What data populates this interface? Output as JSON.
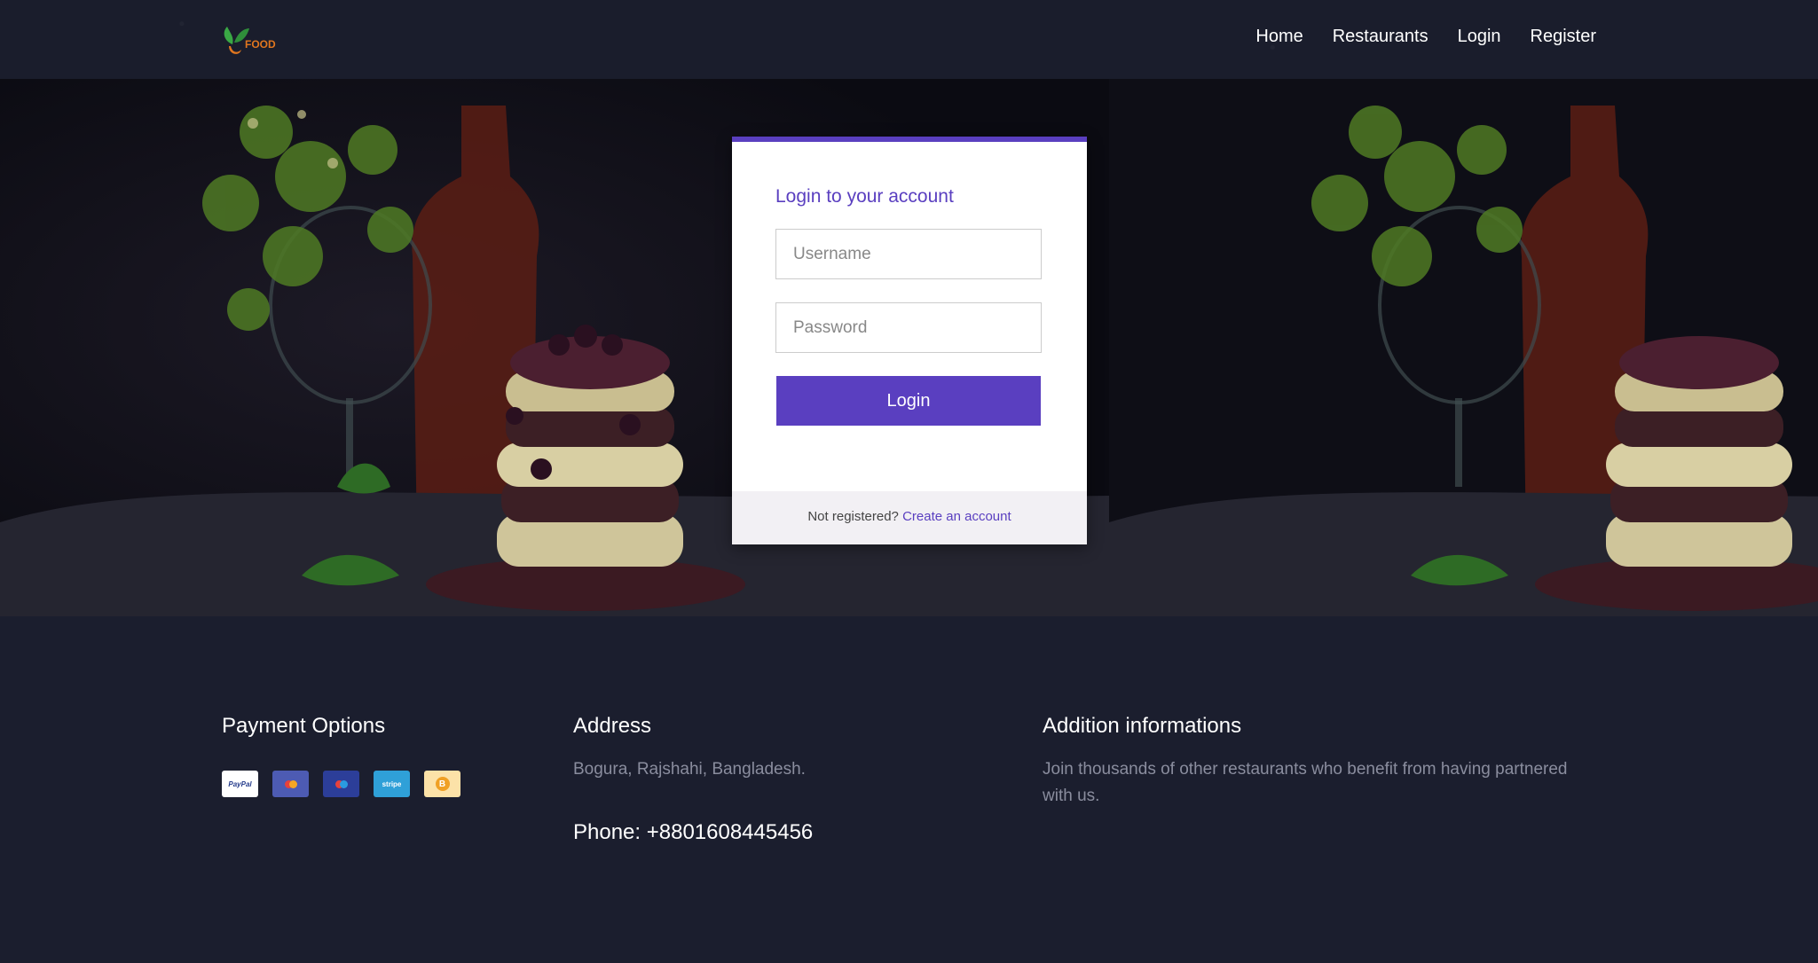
{
  "header": {
    "logo_text": "FOOD",
    "nav": [
      {
        "label": "Home"
      },
      {
        "label": "Restaurants"
      },
      {
        "label": "Login"
      },
      {
        "label": "Register"
      }
    ]
  },
  "login_card": {
    "title": "Login to your account",
    "username_placeholder": "Username",
    "username_value": "",
    "password_placeholder": "Password",
    "password_value": "",
    "login_button": "Login",
    "footer_text": "Not registered?",
    "footer_link": "Create an account",
    "accent_color": "#5a3fc0"
  },
  "footer": {
    "payment": {
      "heading": "Payment Options",
      "methods": [
        {
          "name": "paypal-icon",
          "label": "PayPal"
        },
        {
          "name": "mastercard-icon",
          "label": ""
        },
        {
          "name": "maestro-icon",
          "label": ""
        },
        {
          "name": "stripe-icon",
          "label": "stripe"
        },
        {
          "name": "bitcoin-icon",
          "label": "B"
        }
      ]
    },
    "address": {
      "heading": "Address",
      "text": "Bogura, Rajshahi, Bangladesh.",
      "phone": "Phone: +8801608445456"
    },
    "info": {
      "heading": "Addition informations",
      "text": "Join thousands of other restaurants who benefit from having partnered with us."
    }
  }
}
